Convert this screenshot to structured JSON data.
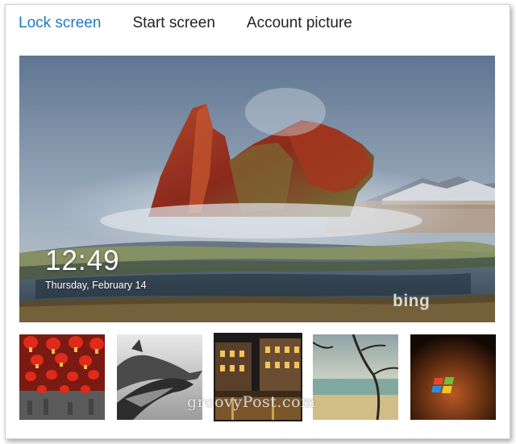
{
  "tabs": [
    {
      "label": "Lock screen",
      "active": true
    },
    {
      "label": "Start screen",
      "active": false
    },
    {
      "label": "Account picture",
      "active": false
    }
  ],
  "preview": {
    "time": "12:49",
    "date": "Thursday, February 14",
    "brand": "bing"
  },
  "thumbnails": [
    {
      "name": "lanterns"
    },
    {
      "name": "dolphins"
    },
    {
      "name": "street-night",
      "selected": true
    },
    {
      "name": "beach"
    },
    {
      "name": "windows-logo"
    }
  ],
  "watermark": "groovyPost.com",
  "colors": {
    "accent": "#1f7ac1",
    "text": "#222222"
  }
}
